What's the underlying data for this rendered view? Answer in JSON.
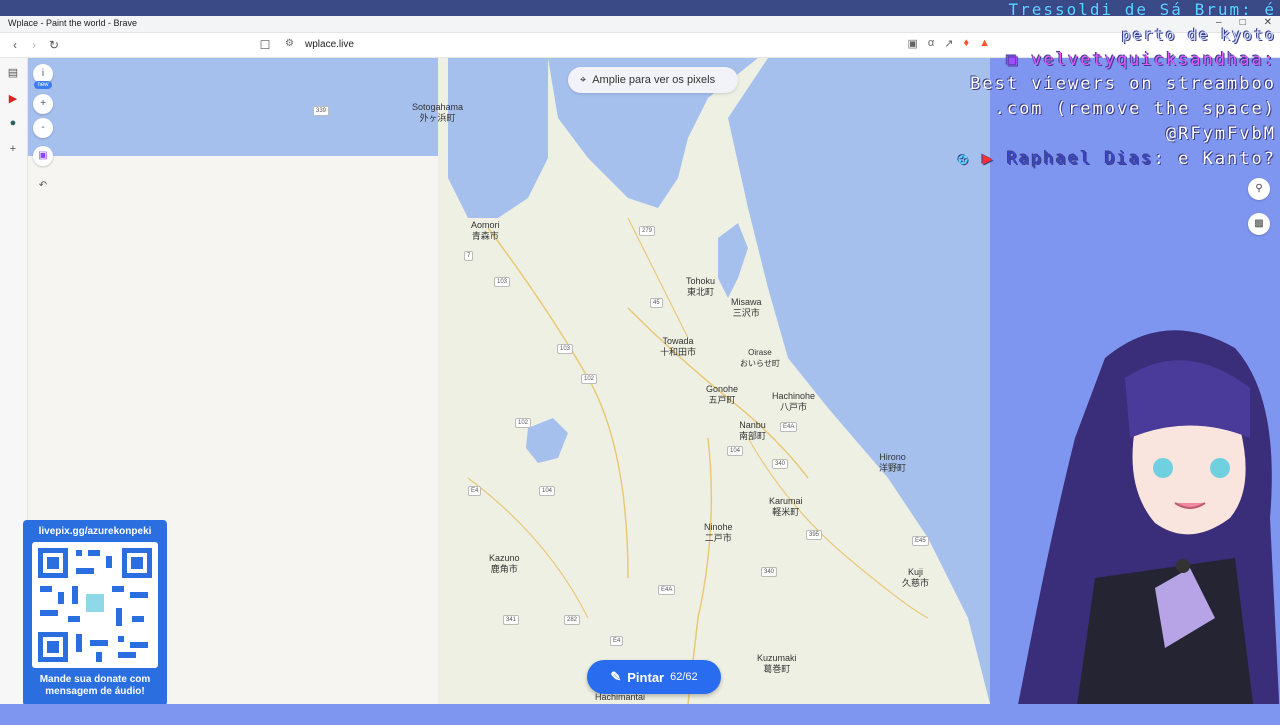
{
  "window": {
    "title": "Wplace - Paint the world - Brave",
    "controls": [
      "–",
      "□",
      "✕"
    ]
  },
  "toolbar": {
    "url": "wplace.live",
    "back_icon": "back-arrow-icon",
    "forward_icon": "forward-arrow-icon",
    "reload_icon": "reload-icon",
    "bookmark_icon": "bookmark-icon"
  },
  "map": {
    "zoom_hint": "Amplie para ver os pixels",
    "labels": [
      {
        "name": "Sotogahama",
        "jp": "外ヶ浜町"
      },
      {
        "name": "Aomori",
        "jp": "青森市"
      },
      {
        "name": "Tohoku",
        "jp": "東北町"
      },
      {
        "name": "Misawa",
        "jp": "三沢市"
      },
      {
        "name": "Towada",
        "jp": "十和田市"
      },
      {
        "name": "Oirase",
        "jp": "おいらせ町"
      },
      {
        "name": "Gonohe",
        "jp": "五戸町"
      },
      {
        "name": "Hachinohe",
        "jp": "八戸市"
      },
      {
        "name": "Nanbu",
        "jp": "南部町"
      },
      {
        "name": "Hirono",
        "jp": "洋野町"
      },
      {
        "name": "Karumai",
        "jp": "軽米町"
      },
      {
        "name": "Ninohe",
        "jp": "二戸市"
      },
      {
        "name": "Kazuno",
        "jp": "鹿角市"
      },
      {
        "name": "Kuji",
        "jp": "久慈市"
      },
      {
        "name": "Kuzumaki",
        "jp": "葛巻町"
      },
      {
        "name": "Hachimantai",
        "jp": ""
      }
    ],
    "roads": [
      "339",
      "279",
      "7",
      "103",
      "4",
      "45",
      "103",
      "102",
      "102",
      "104",
      "E4A",
      "340",
      "E4",
      "104",
      "395",
      "E45",
      "340",
      "E4A",
      "341",
      "282",
      "E4"
    ]
  },
  "paint_button": {
    "label": "Pintar",
    "count": "62/62"
  },
  "qr": {
    "url": "livepix.gg/azurekonpeki",
    "caption_line1": "Mande sua donate com",
    "caption_line2": "mensagem de áudio!"
  },
  "overlay_chat": {
    "line1": "Tressoldi de Sá Brum: é",
    "line2": "perto de kyoto",
    "line3": "velvetyquicksandhaa:",
    "line4": "Best viewers on streamboo",
    "line5": ".com (remove the space)",
    "line6": "@RFymFvbM",
    "line7_name": "Raphael Dias",
    "line7_msg": ": e Kanto?"
  },
  "left_controls": {
    "info": "i",
    "new_badge": "new",
    "zoom_in": "+",
    "zoom_out": "-",
    "back": "↶"
  },
  "colors": {
    "paint_blue": "#2a6cf0",
    "overlay_blue": "#7f96f0",
    "map_water": "#a6c0ee",
    "map_land": "#eef0e4"
  }
}
